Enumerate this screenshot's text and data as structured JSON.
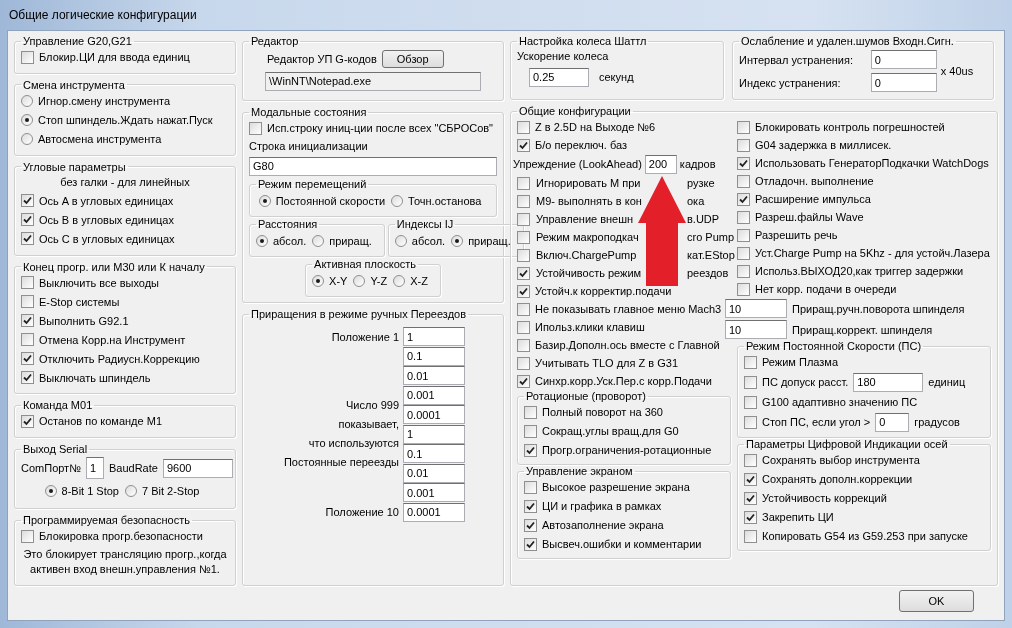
{
  "window": {
    "title": "Общие логические конфигурации"
  },
  "left_column": [
    {
      "title": "Управление G20,G21",
      "items": [
        {
          "kind": "checkbox",
          "label": "Блокир.ЦИ для ввода единиц",
          "checked": false
        }
      ]
    },
    {
      "title": "Смена инструмента",
      "items": [
        {
          "kind": "radio",
          "label": "Игнор.смену инструмента",
          "selected": false
        },
        {
          "kind": "radio",
          "label": "Стоп шпиндель.Ждать нажат.Пуск",
          "selected": true
        },
        {
          "kind": "radio",
          "label": "Автосмена инструмента",
          "selected": false
        }
      ]
    },
    {
      "title": "Угловые параметры",
      "items": [
        {
          "kind": "note",
          "text": "без галки - для линейных"
        },
        {
          "kind": "checkbox",
          "label": "Ось A в угловых единицах",
          "checked": true
        },
        {
          "kind": "checkbox",
          "label": "Ось B в угловых единицах",
          "checked": true
        },
        {
          "kind": "checkbox",
          "label": "Ось C в угловых единицах",
          "checked": true
        }
      ]
    },
    {
      "title": "Конец прогр. или M30 или К началу",
      "items": [
        {
          "kind": "checkbox",
          "label": "Выключить все выходы",
          "checked": false
        },
        {
          "kind": "checkbox",
          "label": "E-Stop системы",
          "checked": false
        },
        {
          "kind": "checkbox",
          "label": "Выполнить G92.1",
          "checked": true
        },
        {
          "kind": "checkbox",
          "label": "Отмена Корр.на Инструмент",
          "checked": false
        },
        {
          "kind": "checkbox",
          "label": "Отключить Радиусн.Коррекцию",
          "checked": true
        },
        {
          "kind": "checkbox",
          "label": "Выключать шпиндель",
          "checked": true
        }
      ]
    },
    {
      "title": "Команда M01",
      "items": [
        {
          "kind": "checkbox",
          "label": "Останов по команде M1",
          "checked": true
        }
      ]
    },
    {
      "title": "Выход Serial",
      "items": [
        {
          "kind": "fields",
          "fields": [
            {
              "label": "ComПорт№",
              "value": "1"
            },
            {
              "label": "BaudRate",
              "value": "9600"
            }
          ]
        },
        {
          "kind": "radios",
          "options": [
            {
              "label": "8-Bit 1 Stop",
              "selected": true
            },
            {
              "label": "7 Bit 2-Stop",
              "selected": false
            }
          ]
        }
      ]
    },
    {
      "title": "Программируемая безопасность",
      "items": [
        {
          "kind": "checkbox",
          "label": "Блокировка прогр.безопасности",
          "checked": false
        },
        {
          "kind": "note",
          "text": "Это блокирует трансляцию прогр.,когда активен вход внешн.управления №1."
        }
      ]
    }
  ],
  "middle_column": [
    {
      "title": "Редактор",
      "items": [
        {
          "kind": "browse",
          "label": "Редактор УП G-кодов",
          "button": "Обзор",
          "value": "\\WinNT\\Notepad.exe"
        }
      ]
    },
    {
      "title": "Модальные состояния",
      "items": [
        {
          "kind": "checkbox",
          "label": "Исп.строку иниц-ции после всех \"СБРОСов\"",
          "checked": false
        },
        {
          "kind": "caption",
          "text": "Строка инициализации"
        },
        {
          "kind": "input",
          "value": "G80"
        },
        {
          "kind": "group",
          "title": "Режим перемещений",
          "items": [
            {
              "kind": "radios",
              "options": [
                {
                  "label": "Постоянной скорости",
                  "selected": true
                },
                {
                  "label": "Точн.останова",
                  "selected": false
                }
              ]
            }
          ]
        },
        {
          "kind": "groups",
          "groups": [
            {
              "title": "Расстояния",
              "items": [
                {
                  "kind": "radios",
                  "options": [
                    {
                      "label": "абсол.",
                      "selected": true
                    },
                    {
                      "label": "приращ.",
                      "selected": false
                    }
                  ]
                }
              ]
            },
            {
              "title": "Индексы IJ",
              "items": [
                {
                  "kind": "radios",
                  "options": [
                    {
                      "label": "абсол.",
                      "selected": false
                    },
                    {
                      "label": "приращ.",
                      "selected": true
                    }
                  ]
                }
              ]
            }
          ]
        },
        {
          "kind": "centered_group",
          "title": "Активная плоскость",
          "items": [
            {
              "kind": "radios",
              "options": [
                {
                  "label": "X-Y",
                  "selected": true
                },
                {
                  "label": "Y-Z",
                  "selected": false
                },
                {
                  "label": "X-Z",
                  "selected": false
                }
              ]
            }
          ]
        }
      ]
    },
    {
      "title": "Приращения в режиме ручных Переездов",
      "items": [
        {
          "kind": "increments",
          "first_label": "Положение 1",
          "note": [
            "Число 999",
            "показывает,",
            "что используются",
            "Постоянные переезды"
          ],
          "last_label": "Положение 10",
          "values": [
            "1",
            "0.1",
            "0.01",
            "0.001",
            "0.0001",
            "1",
            "0.1",
            "0.01",
            "0.001",
            "0.0001"
          ]
        }
      ]
    }
  ],
  "right_top": [
    {
      "title": "Настройка колеса Шаттл",
      "items": [
        {
          "kind": "caption",
          "text": "Ускорение колеса"
        },
        {
          "kind": "field_unit",
          "value": "0.25",
          "unit": "секунд"
        }
      ]
    },
    {
      "title": "Ослабление и удален.шумов Входн.Сигн.",
      "items": [
        {
          "kind": "noise",
          "rows": [
            {
              "label": "Интервал устранения:",
              "value": "0"
            },
            {
              "label": "Индекс устранения:",
              "value": "0"
            }
          ],
          "unit": "x 40us"
        }
      ]
    }
  ],
  "general": {
    "title": "Общие конфигурации",
    "left": [
      {
        "kind": "checkbox",
        "label": "Z в 2.5D на Выходе №6",
        "checked": false
      },
      {
        "kind": "checkbox",
        "label": "Б/о переключ. баз",
        "checked": true
      },
      {
        "kind": "lookahead",
        "label": "Упреждение (LookAhead)",
        "value": "200",
        "unit": "кадров"
      },
      {
        "kind": "covered",
        "label": "Игнорировать М при",
        "tail": "рузке",
        "checked": false
      },
      {
        "kind": "covered",
        "label": "М9- выполнять в кон",
        "tail": "ока",
        "checked": false
      },
      {
        "kind": "covered",
        "label": "Управление внешн",
        "tail": "в.UDP",
        "checked": false
      },
      {
        "kind": "covered",
        "label": "Режим макроподкач",
        "tail": "cro Pump",
        "checked": false
      },
      {
        "kind": "covered",
        "label": "Включ.ChargePump",
        "tail": "кат.EStop",
        "checked": false
      },
      {
        "kind": "covered",
        "label": "Устойчивость режим",
        "tail": "реездов",
        "checked": true
      },
      {
        "kind": "checkbox",
        "label": "Устойч.к корректир.подачи",
        "checked": true
      },
      {
        "kind": "checkbox",
        "label": "Не показывать главное меню Mach3",
        "checked": false
      },
      {
        "kind": "checkbox",
        "label": "Ипольз.клики клавиш",
        "checked": false
      },
      {
        "kind": "checkbox",
        "label": "Базир.Дополн.ось вместе с Главной",
        "checked": false
      },
      {
        "kind": "checkbox",
        "label": "Учитывать TLO для Z в G31",
        "checked": false
      },
      {
        "kind": "checkbox",
        "label": "Синхр.корр.Уск.Пер.с корр.Подачи",
        "checked": true
      },
      {
        "kind": "group",
        "title": "Ротационые (проворот)",
        "items": [
          {
            "kind": "checkbox",
            "label": "Полный поворот на 360",
            "checked": false
          },
          {
            "kind": "checkbox",
            "label": "Сокращ.углы вращ.для G0",
            "checked": false
          },
          {
            "kind": "checkbox",
            "label": "Прогр.ограничения-ротационные",
            "checked": true
          }
        ]
      },
      {
        "kind": "group",
        "title": "Управление экраном",
        "items": [
          {
            "kind": "checkbox",
            "label": "Высокое разрешение экрана",
            "checked": false
          },
          {
            "kind": "checkbox",
            "label": "ЦИ и графика в рамках",
            "checked": true
          },
          {
            "kind": "checkbox",
            "label": "Автозаполнение экрана",
            "checked": true
          },
          {
            "kind": "checkbox",
            "label": "Высвеч.ошибки и комментарии",
            "checked": true
          }
        ]
      }
    ],
    "right": [
      {
        "kind": "checkbox",
        "label": "Блокировать контроль погрешностей",
        "checked": false
      },
      {
        "kind": "checkbox",
        "label": "G04 задержка в миллисек.",
        "checked": false
      },
      {
        "kind": "checkbox",
        "label": "Использовать ГенераторПодкачки WatchDogs",
        "checked": true
      },
      {
        "kind": "checkbox",
        "label": "Отладочн. выполнение",
        "checked": false
      },
      {
        "kind": "checkbox",
        "label": "Расширение импульса",
        "checked": true
      },
      {
        "kind": "checkbox",
        "label": "Разреш.файлы Wave",
        "checked": false
      },
      {
        "kind": "checkbox",
        "label": "Разрешить речь",
        "checked": false
      },
      {
        "kind": "checkbox",
        "label": "Уст.Charge Pump на 5Khz - для устойч.Лазера",
        "checked": false
      },
      {
        "kind": "checkbox",
        "label": "Использ.ВЫХОД20,как триггер задержки",
        "checked": false
      },
      {
        "kind": "checkbox",
        "label": "Нет корр. подачи в очереди",
        "checked": false
      },
      {
        "kind": "field",
        "value": "10",
        "label": "Приращ.ручн.поворота шпинделя"
      },
      {
        "kind": "field",
        "value": "10",
        "label": "Приращ.коррект. шпинделя"
      },
      {
        "kind": "group",
        "title": "Режим Постоянной Скорости (ПС)",
        "items": [
          {
            "kind": "checkbox",
            "label": "Режим Плазма",
            "checked": false
          },
          {
            "kind": "check_field",
            "label": "ПС допуск расст.",
            "value": "180",
            "unit": "единиц",
            "checked": false
          },
          {
            "kind": "checkbox",
            "label": "G100 адаптивно значению ПС",
            "checked": false
          },
          {
            "kind": "check_field",
            "label": "Стоп ПС, если угол >",
            "value": "0",
            "unit": "градусов",
            "checked": false
          }
        ]
      },
      {
        "kind": "group",
        "title": "Параметры Цифровой Индикации осей",
        "items": [
          {
            "kind": "checkbox",
            "label": "Сохранять выбор инструмента",
            "checked": false
          },
          {
            "kind": "checkbox",
            "label": "Сохранять дополн.коррекции",
            "checked": true
          },
          {
            "kind": "checkbox",
            "label": "Устойчивость коррекций",
            "checked": true
          },
          {
            "kind": "checkbox",
            "label": "Закрепить ЦИ",
            "checked": true
          },
          {
            "kind": "checkbox",
            "label": "Копировать G54 из G59.253 при запуске",
            "checked": false
          }
        ]
      }
    ]
  },
  "ok_button": "OK"
}
